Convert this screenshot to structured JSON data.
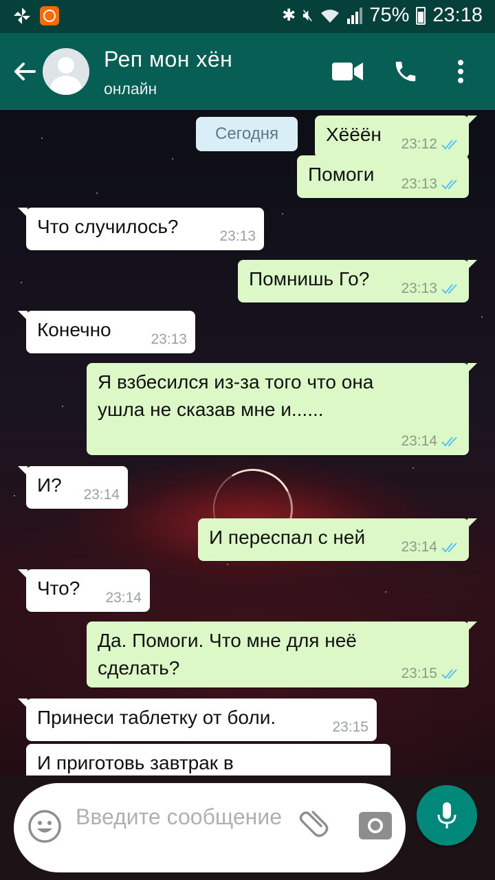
{
  "status_bar": {
    "battery": "75%",
    "time": "23:18"
  },
  "header": {
    "contact_name": "Реп мон хён",
    "contact_status": "онлайн"
  },
  "chat": {
    "date_chip": "Сегодня",
    "messages": [
      {
        "direction": "out",
        "text": "Хёёён",
        "time": "23:12",
        "read": true
      },
      {
        "direction": "out",
        "text": "Помоги",
        "time": "23:13",
        "read": true
      },
      {
        "direction": "in",
        "text": "Что случилось?",
        "time": "23:13"
      },
      {
        "direction": "out",
        "text": "Помнишь Го?",
        "time": "23:13",
        "read": true
      },
      {
        "direction": "in",
        "text": "Конечно",
        "time": "23:13"
      },
      {
        "direction": "out",
        "text": "Я взбесился из-за того что она ушла не сказав мне и......",
        "time": "23:14",
        "read": true
      },
      {
        "direction": "in",
        "text": "И?",
        "time": "23:14"
      },
      {
        "direction": "out",
        "text": "И переспал с ней",
        "time": "23:14",
        "read": true
      },
      {
        "direction": "in",
        "text": "Что?",
        "time": "23:14"
      },
      {
        "direction": "out",
        "text": "Да. Помоги. Что мне для неё сделать?",
        "time": "23:15",
        "read": true
      },
      {
        "direction": "in",
        "text": "Принеси таблетку от боли.",
        "time": "23:15"
      },
      {
        "direction": "in",
        "text": "И приготовь завтрак в",
        "time": ""
      }
    ]
  },
  "composer": {
    "placeholder": "Введите сообщение"
  },
  "colors": {
    "header": "#075e54",
    "status_bar": "#06403a",
    "outgoing_bubble": "#dcf8c6",
    "incoming_bubble": "#ffffff",
    "read_ticks": "#4fc3f7",
    "mic_button": "#00897b"
  },
  "icons": [
    "back-arrow-icon",
    "video-call-icon",
    "phone-icon",
    "more-vert-icon",
    "emoji-icon",
    "attach-icon",
    "camera-icon",
    "mic-icon",
    "double-check-icon"
  ]
}
